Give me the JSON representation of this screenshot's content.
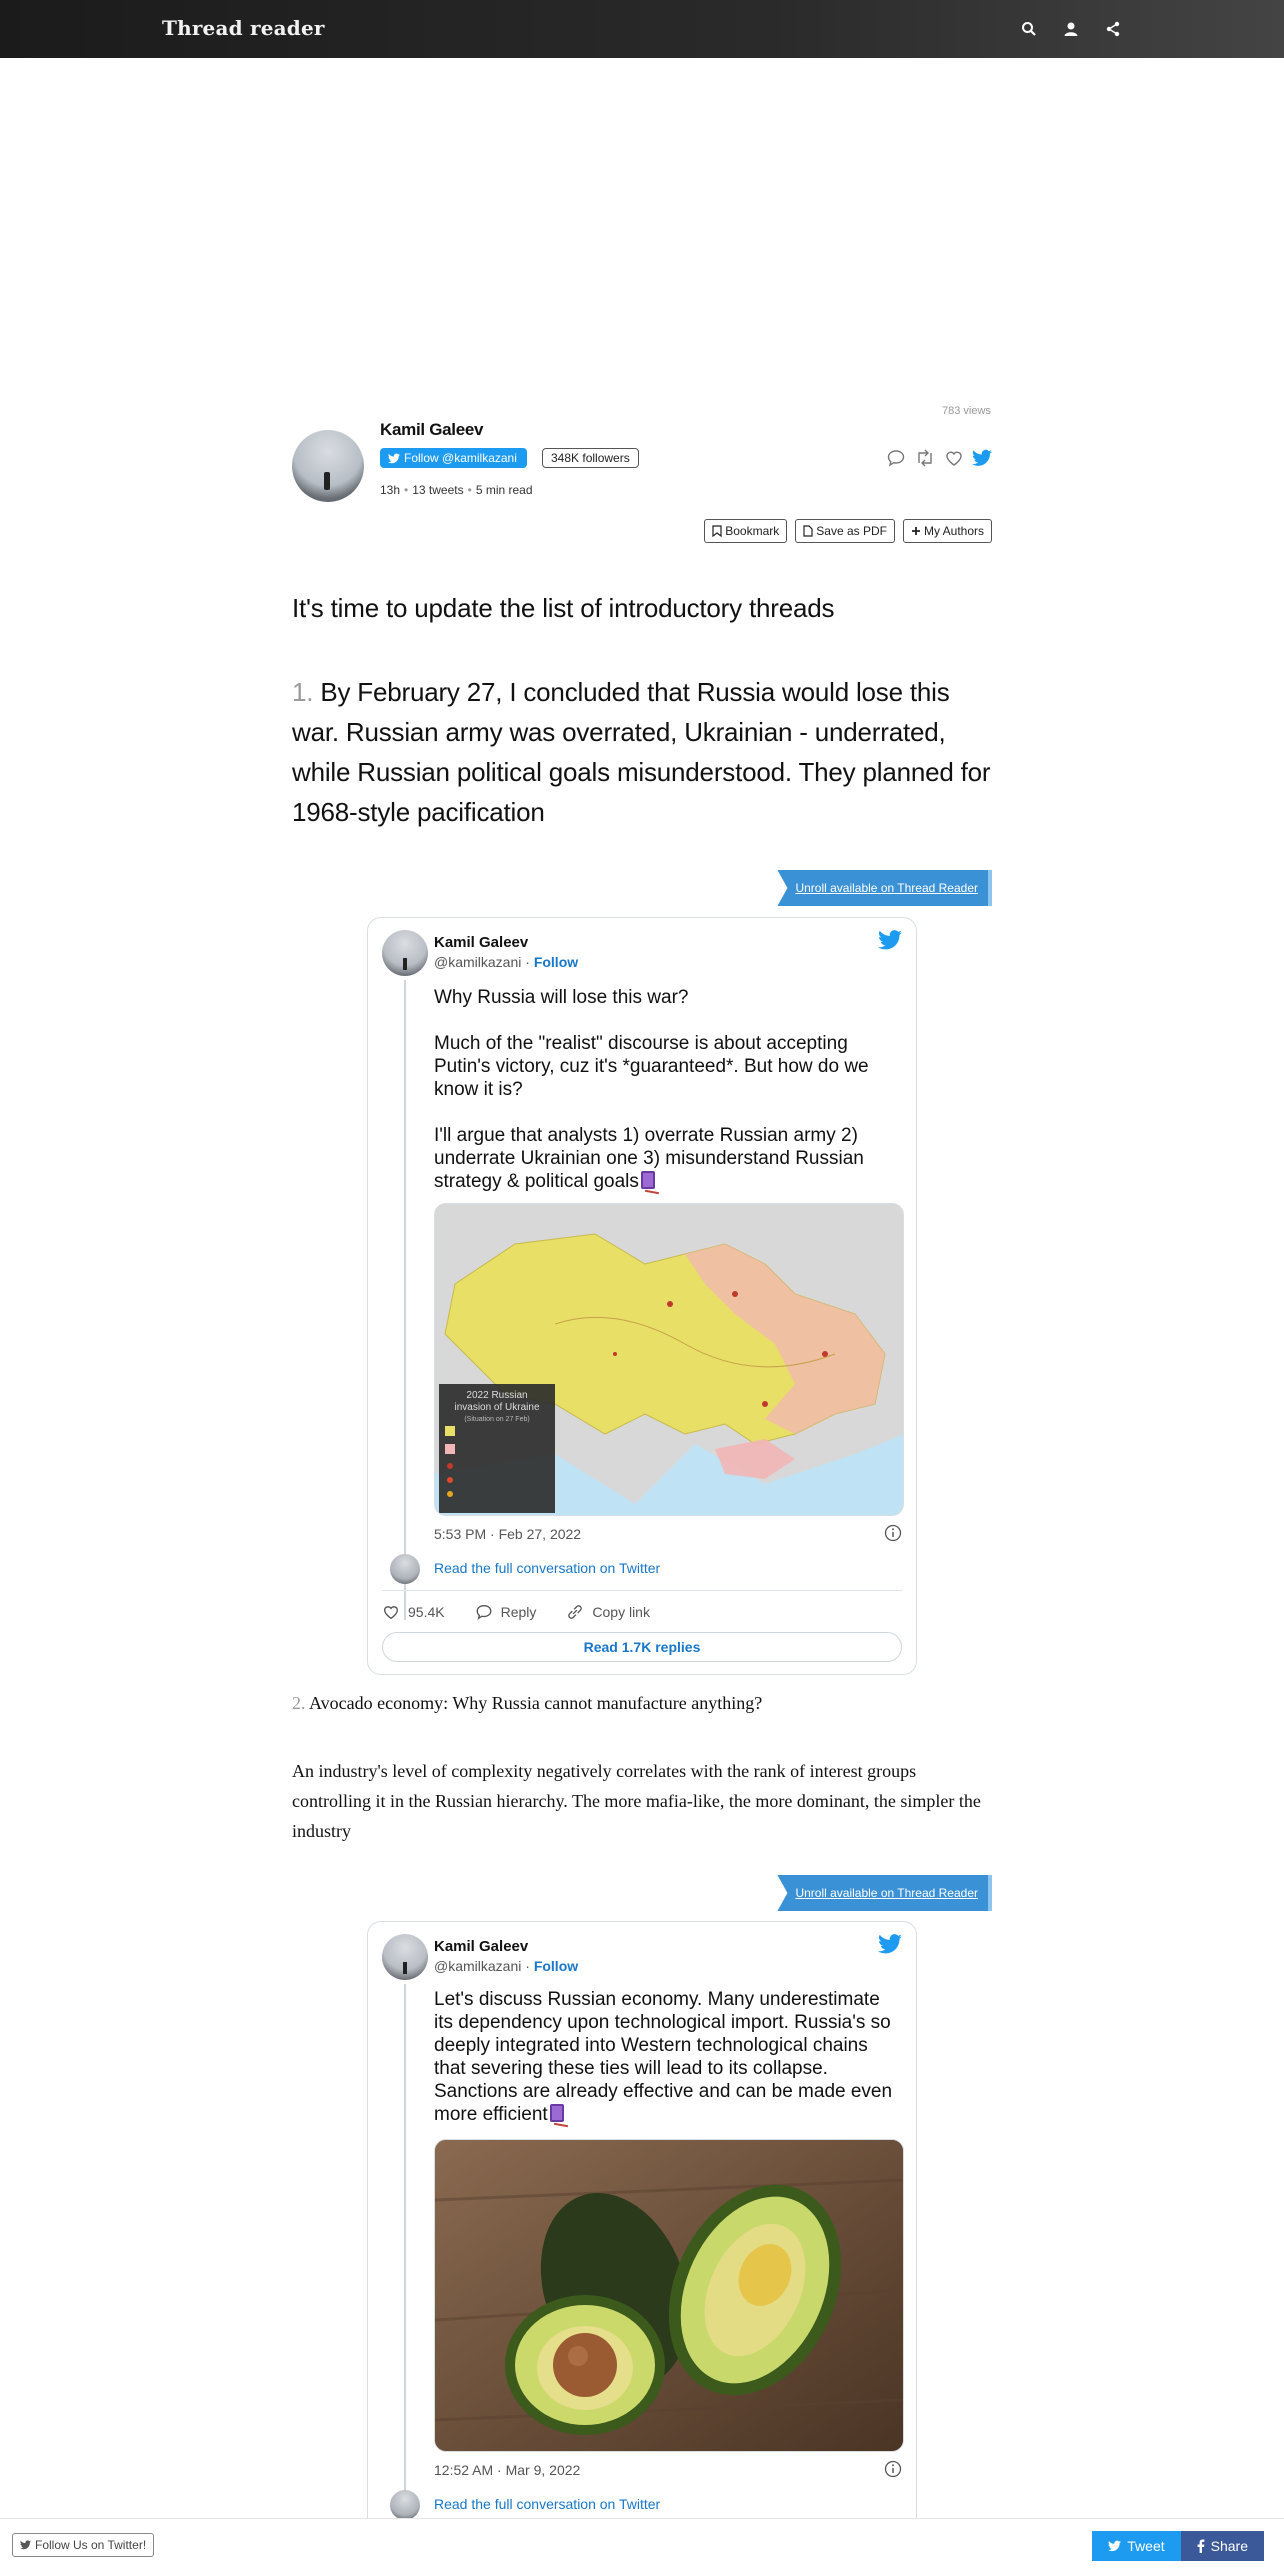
{
  "site": {
    "brand": "Thread reader"
  },
  "nav": {
    "icons": [
      "search-icon",
      "user-icon",
      "share-icon"
    ]
  },
  "author": {
    "views": "783 views",
    "name": "Kamil Galeev",
    "follow_label": "Follow @kamilkazani",
    "followers": "348K followers",
    "age": "13h",
    "tweets": "13 tweets",
    "read_time": "5 min read"
  },
  "tools": {
    "bookmark": "Bookmark",
    "save_pdf": "Save as PDF",
    "my_authors": "My Authors"
  },
  "thread": {
    "intro": "It's time to update the list of introductory threads",
    "t1_num": "1.",
    "t1_text": "By February 27, I concluded that Russia would lose this war. Russian army was overrated, Ukrainian - underrated, while Russian political goals misunderstood. They planned for 1968-style pacification",
    "t2_num": "2.",
    "t2_title": "Avocado economy: Why Russia cannot manufacture anything?",
    "t2_body": "An industry's level of complexity negatively correlates with the rank of interest groups controlling it in the Russian hierarchy. The more mafia-like, the more dominant, the simpler the industry"
  },
  "unroll_label": "Unroll available on Thread Reader",
  "embed1": {
    "name": "Kamil Galeev",
    "handle": "@kamilkazani",
    "follow": "Follow",
    "text": "Why Russia will lose this war?\n\nMuch of the \"realist\" discourse is about accepting Putin's victory, cuz it's *guaranteed*. But how do we know it is?\n\nI'll argue that analysts 1) overrate Russian army 2) underrate Ukrainian one 3) misunderstand Russian strategy & political goals",
    "map_title": "2022 Russian invasion of Ukraine",
    "map_subtitle": "(Situation on 27 Feb)",
    "time": "5:53 PM · Feb 27, 2022",
    "read_conv": "Read the full conversation on Twitter",
    "likes": "95.4K",
    "reply": "Reply",
    "copy_link": "Copy link",
    "read_replies": "Read 1.7K replies"
  },
  "embed2": {
    "name": "Kamil Galeev",
    "handle": "@kamilkazani",
    "follow": "Follow",
    "text": "Let's discuss Russian economy. Many underestimate its dependency upon technological import. Russia's so deeply integrated into Western technological chains that severing these ties will lead to its collapse. Sanctions are already effective and can be made even more efficient",
    "time": "12:52 AM · Mar 9, 2022",
    "read_conv": "Read the full conversation on Twitter"
  },
  "bottom": {
    "follow_us": "Follow Us on Twitter!",
    "tweet": "Tweet",
    "share": "Share"
  },
  "colors": {
    "twitter_blue": "#1d9bf0",
    "unroll_blue": "#3b91d6",
    "facebook_blue": "#3b5998"
  }
}
